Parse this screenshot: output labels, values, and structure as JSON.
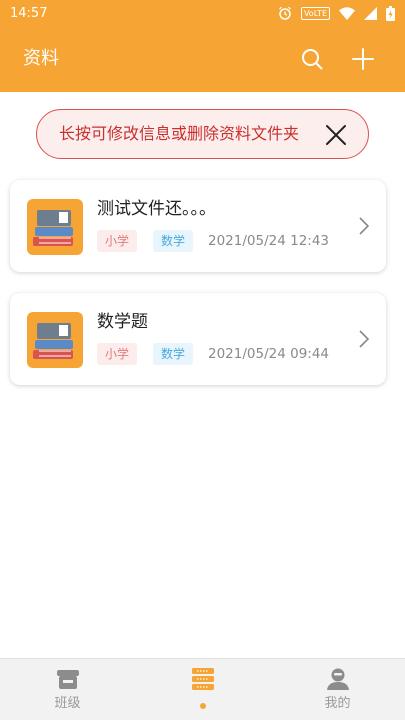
{
  "status_bar": {
    "time": "14:57",
    "volte": "VoLTE"
  },
  "app_bar": {
    "title": "资料",
    "search_icon": "search-icon",
    "add_icon": "plus-icon"
  },
  "hint": {
    "text": "长按可修改信息或删除资料文件夹",
    "close_icon": "close-icon"
  },
  "folders": [
    {
      "title": "测试文件还。。。",
      "level": "小学",
      "subject": "数学",
      "date": "2021/05/24 12:43"
    },
    {
      "title": "数学题",
      "level": "小学",
      "subject": "数学",
      "date": "2021/05/24 09:44"
    }
  ],
  "bottom_nav": {
    "items": [
      {
        "label": "班级",
        "icon": "class-icon"
      },
      {
        "label": "",
        "icon": "materials-icon",
        "active": true
      },
      {
        "label": "我的",
        "icon": "profile-icon"
      }
    ]
  },
  "colors": {
    "accent": "#f6a534",
    "hint_border": "#d9534f",
    "hint_text": "#c9302c"
  }
}
